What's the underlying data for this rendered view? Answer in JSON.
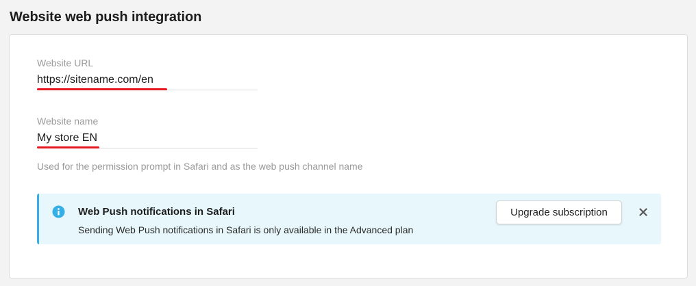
{
  "page": {
    "title": "Website web push integration"
  },
  "form": {
    "website_url": {
      "label": "Website URL",
      "value": "https://sitename.com/en"
    },
    "website_name": {
      "label": "Website name",
      "value": "My store EN",
      "helper": "Used for the permission prompt in Safari and as the web push channel name"
    }
  },
  "alert": {
    "icon": "info-icon",
    "title": "Web Push notifications in Safari",
    "body": "Sending Web Push notifications in Safari is only available in the Advanced plan",
    "action_label": "Upgrade subscription",
    "close_icon": "close-icon"
  },
  "colors": {
    "accent_info": "#36aee6",
    "alert_background": "#e7f7fc",
    "highlight_red": "#e4181e"
  }
}
